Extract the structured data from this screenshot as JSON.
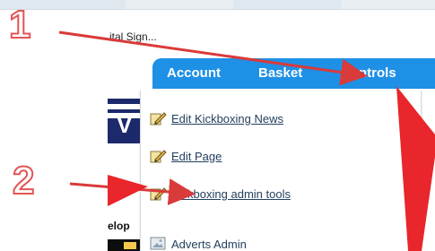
{
  "browser": {
    "bookmark_text": "ital Sign..."
  },
  "nav": {
    "items": [
      {
        "label": "Account"
      },
      {
        "label": "Basket"
      },
      {
        "label": "Controls"
      }
    ]
  },
  "dropdown": {
    "items": [
      {
        "label": "Edit Kickboxing News",
        "icon": "edit-pencil-icon"
      },
      {
        "label": "Edit Page",
        "icon": "edit-pencil-icon"
      },
      {
        "label": "Kickboxing admin tools",
        "icon": "edit-pencil-icon"
      },
      {
        "label": "Adverts Admin",
        "icon": "image-icon"
      }
    ]
  },
  "left_page": {
    "subtext": "elop"
  },
  "annotations": {
    "numerals": [
      "1",
      "2"
    ],
    "arrow_color": "#d93a3a"
  },
  "colors": {
    "nav_blue": "#1e90e6",
    "link_color": "#24405e",
    "annotation_red": "#e25454"
  }
}
